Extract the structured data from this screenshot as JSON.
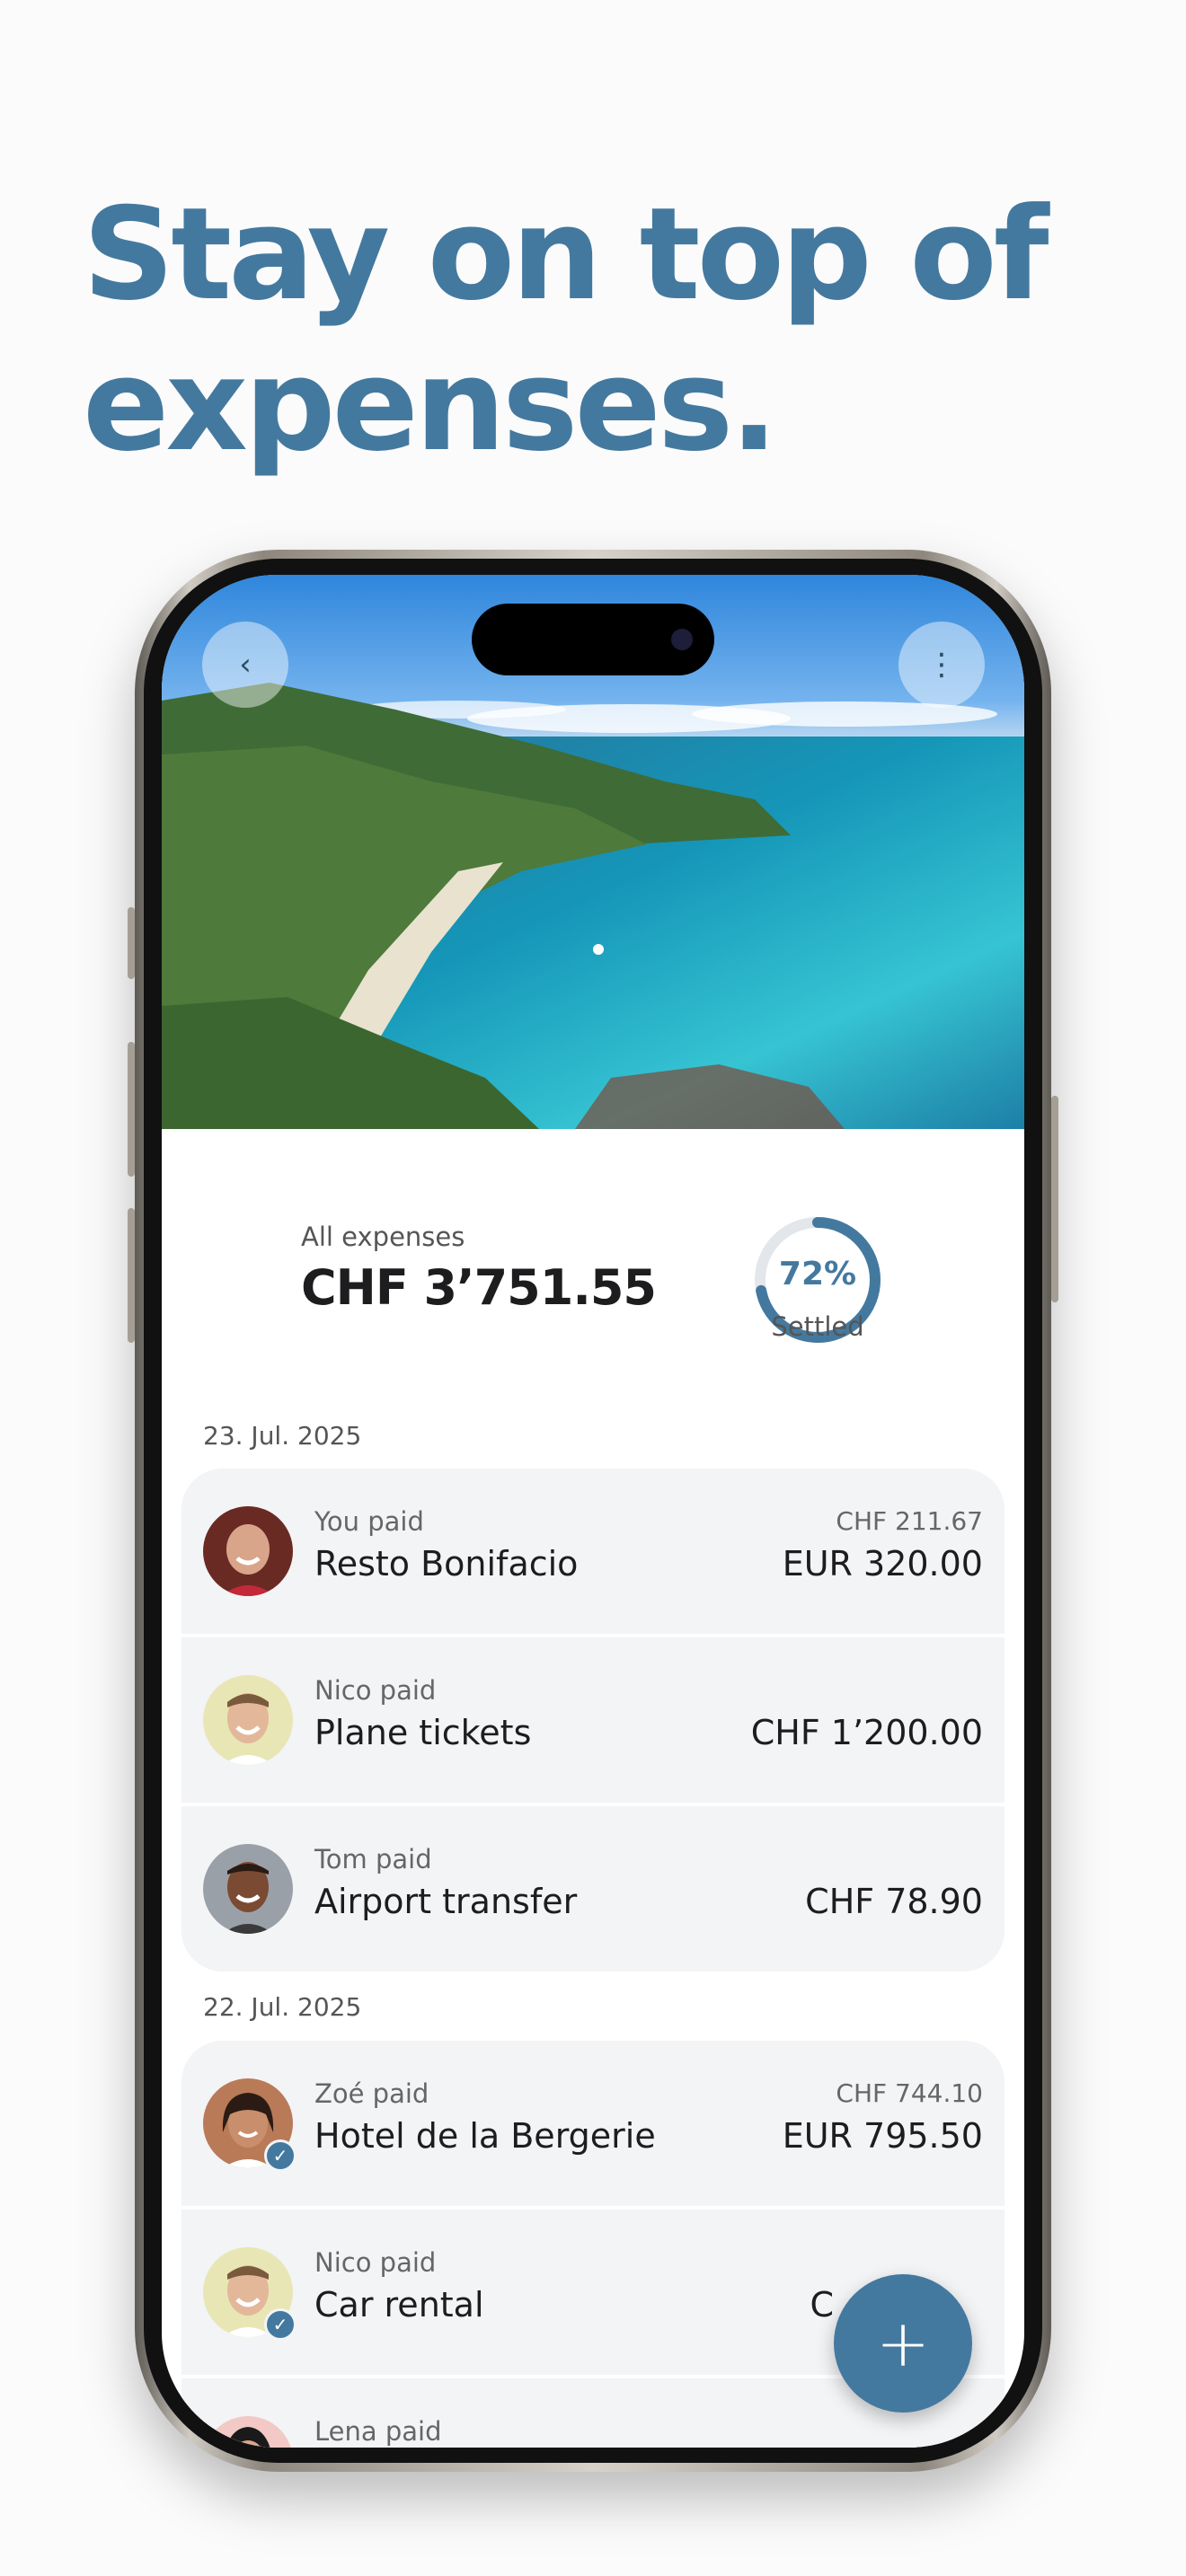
{
  "headline": {
    "line1": "Stay on top of",
    "line2": "expenses."
  },
  "header": {
    "back_icon": "chevron-left-icon",
    "more_icon": "more-vertical-icon"
  },
  "summary": {
    "label": "All expenses",
    "total": "CHF 3’751.55",
    "settled_percent": 72,
    "settled_text": "72%",
    "settled_label": "Settled"
  },
  "days": [
    {
      "date": "23. Jul. 2025",
      "expenses": [
        {
          "payer": "You paid",
          "title": "Resto Bonifacio",
          "converted": "CHF 211.67",
          "amount": "EUR 320.00",
          "settled": false
        },
        {
          "payer": "Nico paid",
          "title": "Plane tickets",
          "converted": "",
          "amount": "CHF 1’200.00",
          "settled": false
        },
        {
          "payer": "Tom paid",
          "title": "Airport transfer",
          "converted": "",
          "amount": "CHF 78.90",
          "settled": false
        }
      ]
    },
    {
      "date": "22. Jul. 2025",
      "expenses": [
        {
          "payer": "Zoé paid",
          "title": "Hotel de la Bergerie",
          "converted": "CHF 744.10",
          "amount": "EUR 795.50",
          "settled": true
        },
        {
          "payer": "Nico paid",
          "title": "Car rental",
          "converted": "",
          "amount": "C",
          "settled": true
        },
        {
          "payer": "Lena paid",
          "title": "",
          "converted": "",
          "amount": "",
          "settled": false
        }
      ]
    }
  ],
  "fab": {
    "label": "+"
  },
  "colors": {
    "accent": "#44799f",
    "row_bg": "#f3f4f6"
  }
}
